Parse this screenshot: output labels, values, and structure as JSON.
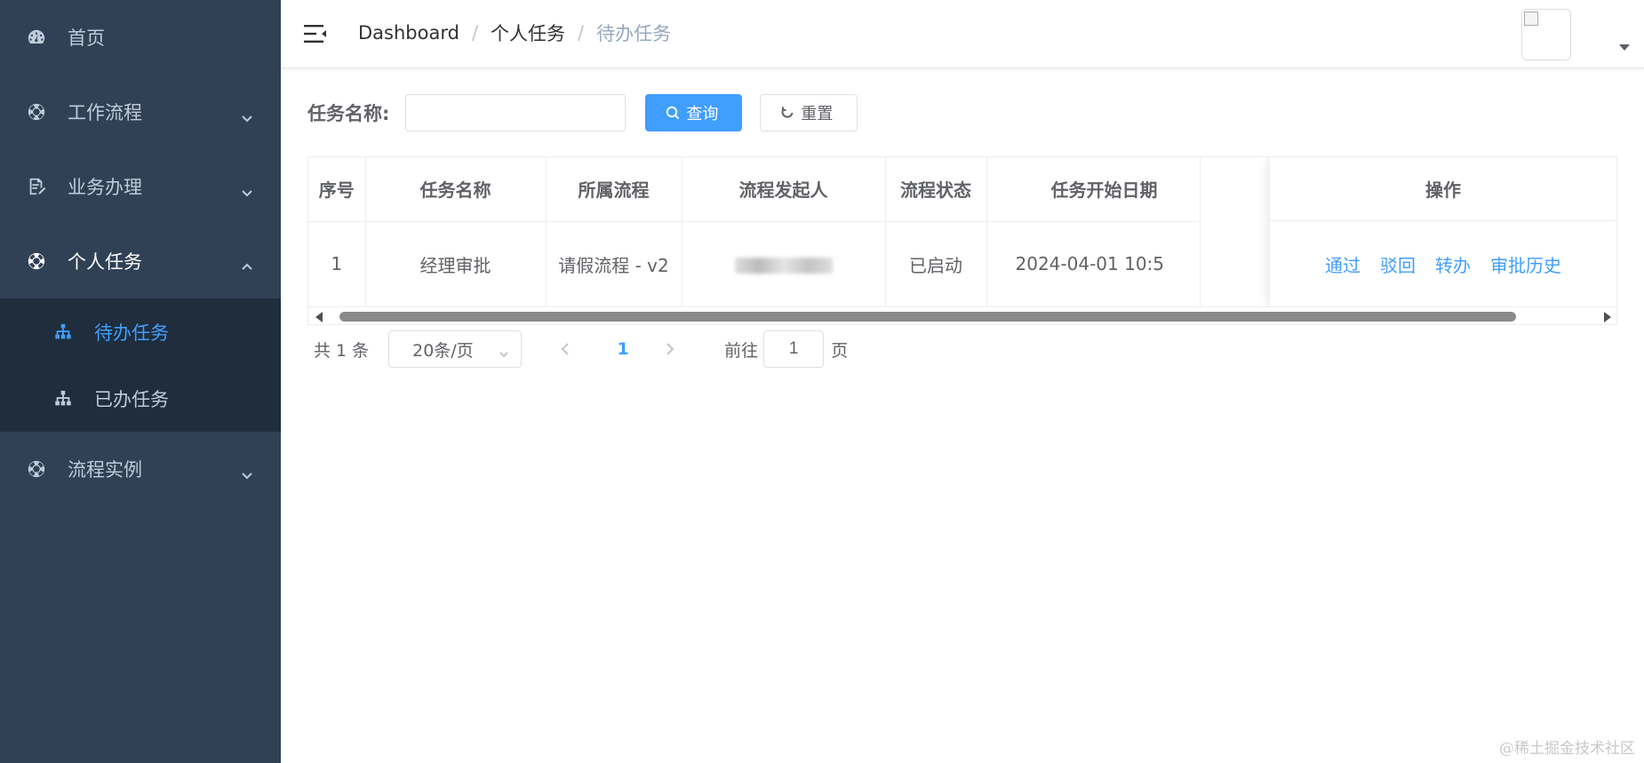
{
  "sidebar": {
    "items": [
      {
        "label": "首页",
        "icon": "dashboard-icon"
      },
      {
        "label": "工作流程",
        "icon": "lifebuoy-icon",
        "expandable": true
      },
      {
        "label": "业务办理",
        "icon": "document-edit-icon",
        "expandable": true
      },
      {
        "label": "个人任务",
        "icon": "lifebuoy-icon",
        "expandable": true,
        "open": true,
        "children": [
          {
            "label": "待办任务",
            "icon": "tree-icon",
            "active": true
          },
          {
            "label": "已办任务",
            "icon": "tree-icon"
          }
        ]
      },
      {
        "label": "流程实例",
        "icon": "lifebuoy-icon",
        "expandable": true
      }
    ]
  },
  "header": {
    "breadcrumb": [
      "Dashboard",
      "个人任务",
      "待办任务"
    ],
    "breadcrumb_separator": "/"
  },
  "search": {
    "label": "任务名称:",
    "value": "",
    "placeholder": "",
    "query_label": "查询",
    "reset_label": "重置"
  },
  "table": {
    "columns": [
      "序号",
      "任务名称",
      "所属流程",
      "流程发起人",
      "流程状态",
      "任务开始日期",
      "操作"
    ],
    "rows": [
      {
        "index": "1",
        "task_name": "经理审批",
        "process": "请假流程 - v2",
        "initiator": "",
        "status": "已启动",
        "start_date": "2024-04-01 10:5",
        "actions": [
          "通过",
          "驳回",
          "转办",
          "审批历史"
        ]
      }
    ]
  },
  "pagination": {
    "total_text": "共 1 条",
    "page_size": "20条/页",
    "current_page": "1",
    "goto_label": "前往",
    "goto_value": "1",
    "page_suffix": "页"
  },
  "watermark": "@稀土掘金技术社区",
  "colors": {
    "sidebar_bg": "#304156",
    "submenu_bg": "#1f2d3d",
    "primary": "#409eff"
  }
}
